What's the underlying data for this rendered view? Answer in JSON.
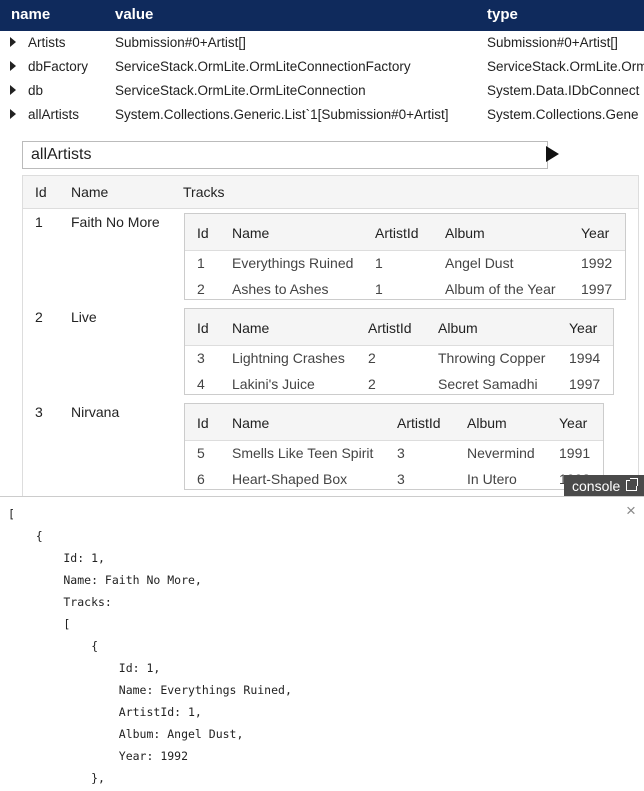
{
  "variables": {
    "headers": {
      "name": "name",
      "value": "value",
      "type": "type"
    },
    "rows": [
      {
        "name": "Artists",
        "value": "Submission#0+Artist[]",
        "type": "Submission#0+Artist[]"
      },
      {
        "name": "dbFactory",
        "value": "ServiceStack.OrmLite.OrmLiteConnectionFactory",
        "type": "ServiceStack.OrmLite.Orm"
      },
      {
        "name": "db",
        "value": "ServiceStack.OrmLite.OrmLiteConnection",
        "type": "System.Data.IDbConnect"
      },
      {
        "name": "allArtists",
        "value": "System.Collections.Generic.List`1[Submission#0+Artist]",
        "type": "System.Collections.Gene"
      }
    ]
  },
  "expression": {
    "value": "allArtists"
  },
  "results": {
    "headers": [
      "Id",
      "Name",
      "Tracks"
    ],
    "artists": [
      {
        "id": "1",
        "name": "Faith No More",
        "track_headers": [
          "Id",
          "Name",
          "ArtistId",
          "Album",
          "Year"
        ],
        "tracks": [
          [
            "1",
            "Everythings Ruined",
            "1",
            "Angel Dust",
            "1992"
          ],
          [
            "2",
            "Ashes to Ashes",
            "1",
            "Album of the Year",
            "1997"
          ]
        ]
      },
      {
        "id": "2",
        "name": "Live",
        "track_headers": [
          "Id",
          "Name",
          "ArtistId",
          "Album",
          "Year"
        ],
        "tracks": [
          [
            "3",
            "Lightning Crashes",
            "2",
            "Throwing Copper",
            "1994"
          ],
          [
            "4",
            "Lakini's Juice",
            "2",
            "Secret Samadhi",
            "1997"
          ]
        ]
      },
      {
        "id": "3",
        "name": "Nirvana",
        "track_headers": [
          "Id",
          "Name",
          "ArtistId",
          "Album",
          "Year"
        ],
        "tracks": [
          [
            "5",
            "Smells Like Teen Spirit",
            "3",
            "Nevermind",
            "1991"
          ],
          [
            "6",
            "Heart-Shaped Box",
            "3",
            "In Utero",
            "1993"
          ]
        ]
      }
    ]
  },
  "console_button": {
    "label": "console",
    "icon": "external-link-icon"
  },
  "console": {
    "close_label": "×",
    "lines": [
      "[",
      "    {",
      "        Id: 1,",
      "        Name: Faith No More,",
      "        Tracks:",
      "        [",
      "            {",
      "                Id: 1,",
      "                Name: Everythings Ruined,",
      "                ArtistId: 1,",
      "                Album: Angel Dust,",
      "                Year: 1992",
      "            },"
    ]
  }
}
